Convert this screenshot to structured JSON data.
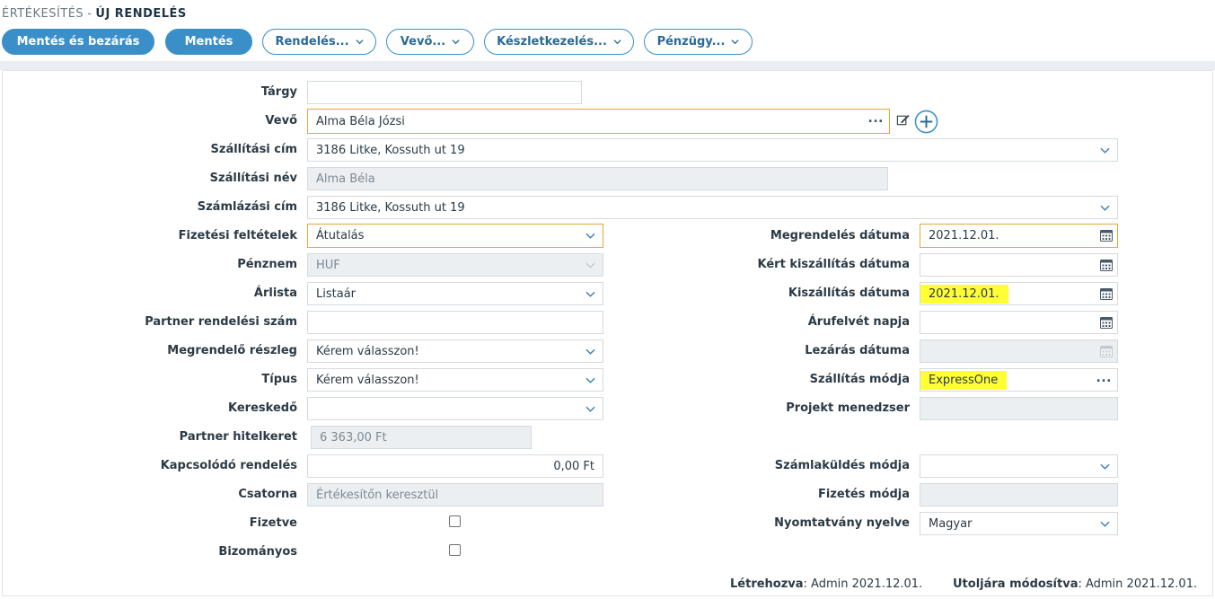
{
  "breadcrumb": {
    "section": "ÉRTÉKESÍTÉS",
    "separator": "-",
    "current": "ÚJ RENDELÉS"
  },
  "toolbar": {
    "save_close": "Mentés és bezárás",
    "save": "Mentés",
    "order_menu": "Rendelés...",
    "customer_menu": "Vevő...",
    "inventory_menu": "Készletkezelés...",
    "finance_menu": "Pénzügy..."
  },
  "form": {
    "subject": {
      "label": "Tárgy",
      "value": ""
    },
    "customer": {
      "label": "Vevő",
      "value": "Alma Béla Józsi"
    },
    "shipping_address": {
      "label": "Szállítási cím",
      "value": "3186 Litke, Kossuth ut 19"
    },
    "shipping_name": {
      "label": "Szállítási név",
      "value": "Alma Béla"
    },
    "billing_address": {
      "label": "Számlázási cím",
      "value": "3186 Litke, Kossuth ut 19"
    },
    "payment_terms": {
      "label": "Fizetési feltételek",
      "value": "Átutalás"
    },
    "currency": {
      "label": "Pénznem",
      "value": "HUF"
    },
    "price_list": {
      "label": "Árlista",
      "value": "Listaár"
    },
    "partner_order_number": {
      "label": "Partner rendelési szám",
      "value": ""
    },
    "ordering_department": {
      "label": "Megrendelő részleg",
      "value": "Kérem válasszon!"
    },
    "type": {
      "label": "Típus",
      "value": "Kérem válasszon!"
    },
    "salesperson": {
      "label": "Kereskedő",
      "value": ""
    },
    "partner_credit_limit": {
      "label": "Partner hitelkeret",
      "value": "6 363,00 Ft"
    },
    "related_order": {
      "label": "Kapcsolódó rendelés",
      "value": "0,00 Ft"
    },
    "channel": {
      "label": "Csatorna",
      "value": "Értékesítőn keresztül"
    },
    "paid": {
      "label": "Fizetve",
      "checked": false
    },
    "consignment": {
      "label": "Bizományos",
      "checked": false
    },
    "order_date": {
      "label": "Megrendelés dátuma",
      "value": "2021.12.01."
    },
    "requested_delivery_date": {
      "label": "Kért kiszállítás dátuma",
      "value": ""
    },
    "delivery_date": {
      "label": "Kiszállítás dátuma",
      "value": "2021.12.01."
    },
    "pickup_day": {
      "label": "Árufelvét napja",
      "value": ""
    },
    "closing_date": {
      "label": "Lezárás dátuma",
      "value": ""
    },
    "shipping_method": {
      "label": "Szállítás módja",
      "value": "ExpressOne"
    },
    "project_manager": {
      "label": "Projekt menedzser",
      "value": ""
    },
    "invoice_delivery_method": {
      "label": "Számlaküldés módja",
      "value": ""
    },
    "payment_method": {
      "label": "Fizetés módja",
      "value": ""
    },
    "print_language": {
      "label": "Nyomtatvány nyelve",
      "value": "Magyar"
    }
  },
  "footer": {
    "created_label": "Létrehozva",
    "created_value": ": Admin 2021.12.01.",
    "modified_label": "Utoljára módosítva",
    "modified_value": ": Admin 2021.12.01."
  },
  "colors": {
    "accent": "#3a8fc8",
    "highlight": "#ffff33",
    "focus_border": "#e8a43a"
  }
}
